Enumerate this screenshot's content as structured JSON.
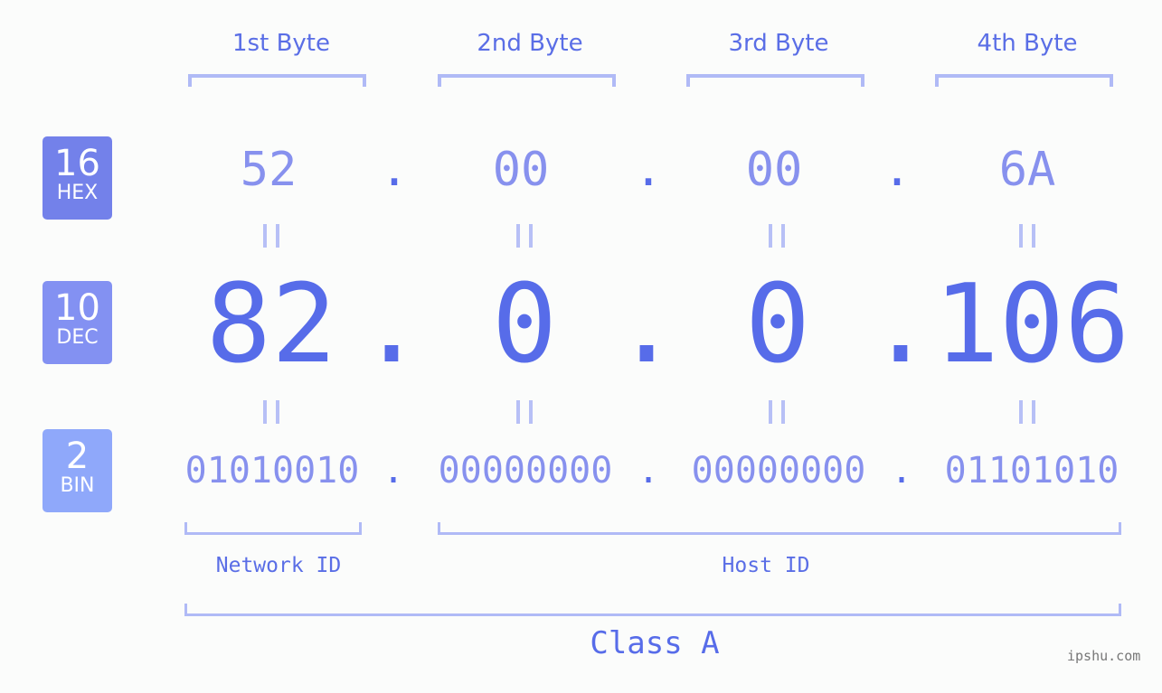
{
  "bytes": [
    "1st Byte",
    "2nd Byte",
    "3rd Byte",
    "4th Byte"
  ],
  "badges": {
    "hex": {
      "num": "16",
      "label": "HEX",
      "color": "#7381ea"
    },
    "dec": {
      "num": "10",
      "label": "DEC",
      "color": "#8391f2"
    },
    "bin": {
      "num": "2",
      "label": "BIN",
      "color": "#8fa8fa"
    }
  },
  "hex": [
    "52",
    "00",
    "00",
    "6A"
  ],
  "dec": [
    "82",
    "0",
    "0",
    "106"
  ],
  "bin": [
    "01010010",
    "00000000",
    "00000000",
    "01101010"
  ],
  "separator": ".",
  "network_label": "Network ID",
  "host_label": "Host ID",
  "class_label": "Class A",
  "watermark": "ipshu.com"
}
